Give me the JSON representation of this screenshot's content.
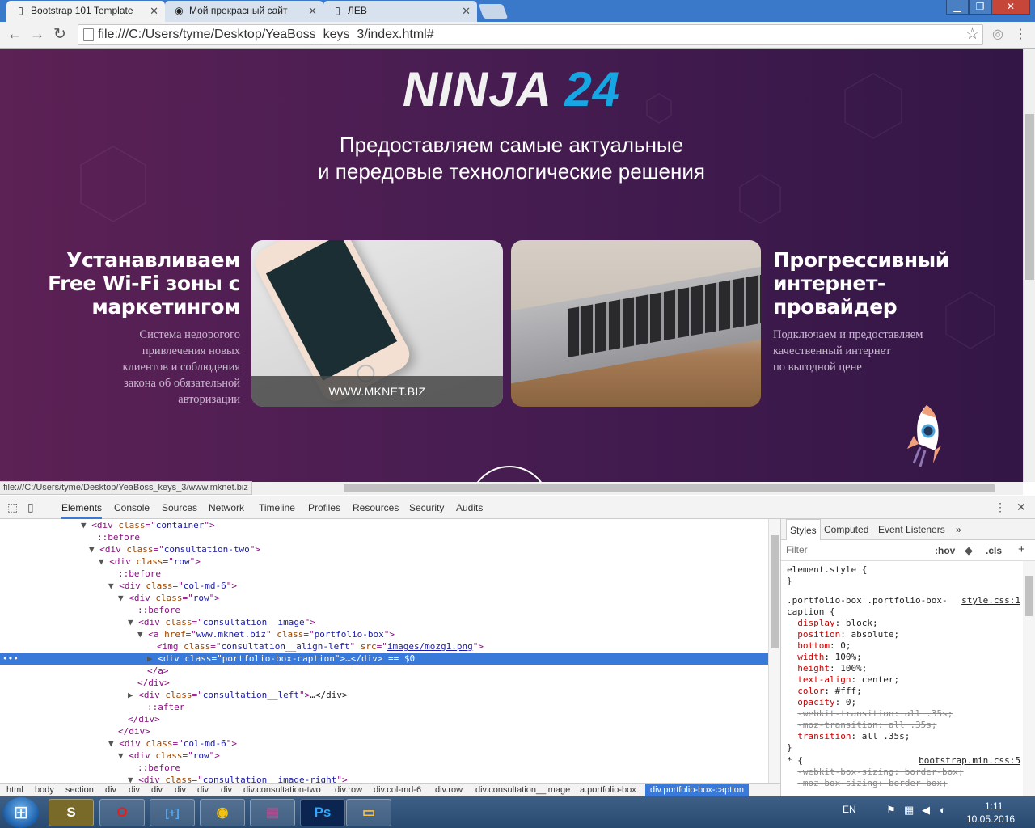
{
  "browser": {
    "tabs": [
      {
        "title": "Bootstrap 101 Template",
        "icon": "page-icon"
      },
      {
        "title": "Мой прекрасный сайт",
        "icon": "globe-icon"
      },
      {
        "title": "ЛЕВ",
        "icon": "page-icon"
      }
    ],
    "url": "file:///C:/Users/tyme/Desktop/YeaBoss_keys_3/index.html#",
    "status_url": "file:///C:/Users/tyme/Desktop/YeaBoss_keys_3/www.mknet.biz"
  },
  "site": {
    "logo_text": "NINJA",
    "logo_number": "24",
    "tagline_line1": "Предоставляем самые актуальные",
    "tagline_line2": "и передовые технологические решения",
    "left_title_1": "Устанавливаем",
    "left_title_2": "Free Wi-Fi зоны с",
    "left_title_3": "маркетингом",
    "left_desc": [
      "Система недорогого",
      "привлечения новых",
      "клиентов и соблюдения",
      "закона об обязательной",
      "авторизации"
    ],
    "card1_caption": "WWW.MKNET.BIZ",
    "right_title_1": "Прогрессивный",
    "right_title_2": "интернет-",
    "right_title_3": "провайдер",
    "right_desc": [
      "Подключаем и предоставляем",
      "качественный интернет",
      "по выгодной цене"
    ]
  },
  "devtools": {
    "tabs": [
      "Elements",
      "Console",
      "Sources",
      "Network",
      "Timeline",
      "Profiles",
      "Resources",
      "Security",
      "Audits"
    ],
    "breadcrumbs": [
      "html",
      "body",
      "section",
      "div",
      "div",
      "div",
      "div",
      "div",
      "div",
      "div.consultation-two",
      "div.row",
      "div.col-md-6",
      "div.row",
      "div.consultation__image",
      "a.portfolio-box",
      "div.portfolio-box-caption"
    ],
    "styles_tabs": [
      "Styles",
      "Computed",
      "Event Listeners"
    ],
    "filter_placeholder": "Filter",
    "hov": ":hov",
    "cls": ".cls",
    "element_style": "element.style {",
    "rule_selector_1": ".portfolio-box .portfolio-box-",
    "rule_selector_2": "caption {",
    "rule_source": "style.css:1",
    "rule2_selector": "* {",
    "rule2_source": "bootstrap.min.css:5",
    "declarations": [
      {
        "prop": "display",
        "value": "block;"
      },
      {
        "prop": "position",
        "value": "absolute;"
      },
      {
        "prop": "bottom",
        "value": "0;"
      },
      {
        "prop": "width",
        "value": "100%;"
      },
      {
        "prop": "height",
        "value": "100%;"
      },
      {
        "prop": "text-align",
        "value": "center;"
      },
      {
        "prop": "color",
        "value": "#fff;"
      },
      {
        "prop": "opacity",
        "value": "0;"
      },
      {
        "prop": "-webkit-transition",
        "value": "all .35s;"
      },
      {
        "prop": "-moz-transition",
        "value": "all .35s;"
      },
      {
        "prop": "transition",
        "value": "all .35s;"
      }
    ],
    "rule2_declarations": [
      {
        "prop": "-webkit-box-sizing",
        "value": "border-box;"
      },
      {
        "prop": "-moz-box-sizing",
        "value": "border-box;"
      }
    ],
    "dom_lines": [
      {
        "t": "▼",
        "open": "div",
        "attrs": [
          [
            "class",
            "container"
          ]
        ],
        "tail": ""
      },
      {
        "pseudo": "::before"
      },
      {
        "t": "▼",
        "open": "div",
        "attrs": [
          [
            "class",
            "consultation-two"
          ]
        ],
        "tail": ""
      },
      {
        "t": "▼",
        "open": "div",
        "attrs": [
          [
            "class",
            "row"
          ]
        ],
        "tail": ""
      },
      {
        "pseudo": "::before"
      },
      {
        "t": "▼",
        "open": "div",
        "attrs": [
          [
            "class",
            "col-md-6"
          ]
        ],
        "tail": ""
      },
      {
        "t": "▼",
        "open": "div",
        "attrs": [
          [
            "class",
            "row"
          ]
        ],
        "tail": ""
      },
      {
        "pseudo": "::before"
      },
      {
        "t": "▼",
        "open": "div",
        "attrs": [
          [
            "class",
            "consultation__image"
          ]
        ],
        "tail": ""
      },
      {
        "t": "▼",
        "open": "a",
        "attrs": [
          [
            "href",
            "www.mknet.biz"
          ],
          [
            "class",
            "portfolio-box"
          ]
        ],
        "tail": ""
      },
      {
        "t": "",
        "open": "img",
        "attrs": [
          [
            "class",
            "consultation__align-left"
          ],
          [
            "src",
            "images/mozg1.png"
          ]
        ],
        "tail": ""
      },
      {
        "t": "▶",
        "open": "div",
        "attrs": [
          [
            "class",
            "portfolio-box-caption"
          ]
        ],
        "tail": "…</div> == $0"
      },
      {
        "close": "a"
      },
      {
        "close": "div"
      },
      {
        "t": "▶",
        "open": "div",
        "attrs": [
          [
            "class",
            "consultation__left"
          ]
        ],
        "tail": "…</div>"
      },
      {
        "pseudo": "::after"
      },
      {
        "close": "div"
      },
      {
        "close": "div"
      },
      {
        "t": "▼",
        "open": "div",
        "attrs": [
          [
            "class",
            "col-md-6"
          ]
        ],
        "tail": ""
      },
      {
        "t": "▼",
        "open": "div",
        "attrs": [
          [
            "class",
            "row"
          ]
        ],
        "tail": ""
      },
      {
        "pseudo": "::before"
      },
      {
        "t": "▼",
        "open": "div",
        "attrs": [
          [
            "class",
            "consultation__image-right"
          ]
        ],
        "tail": ""
      }
    ]
  },
  "taskbar": {
    "lang": "EN",
    "time": "1:11",
    "date": "10.05.2016"
  }
}
